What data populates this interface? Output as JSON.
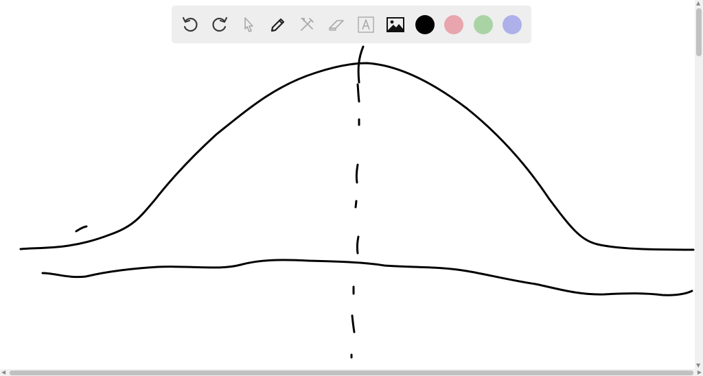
{
  "toolbar": {
    "tools": [
      {
        "name": "undo-icon"
      },
      {
        "name": "redo-icon"
      },
      {
        "name": "select-arrow-icon"
      },
      {
        "name": "pencil-icon"
      },
      {
        "name": "tools-icon"
      },
      {
        "name": "eraser-icon"
      },
      {
        "name": "text-box-icon"
      },
      {
        "name": "image-icon"
      }
    ],
    "colors": [
      "#000000",
      "#e8a5ae",
      "#a9d3a5",
      "#aeb0ea"
    ],
    "selected_color": "#000000"
  },
  "drawing": {
    "stroke_color": "#000000",
    "strokes": [
      "bell-curve",
      "horizontal-wavy-line",
      "dashed-vertical-line",
      "small-tick-mark"
    ]
  },
  "scrollbars": {
    "up_arrow": "▲",
    "down_arrow": "▼",
    "left_arrow": "◀",
    "right_arrow": "▶"
  }
}
